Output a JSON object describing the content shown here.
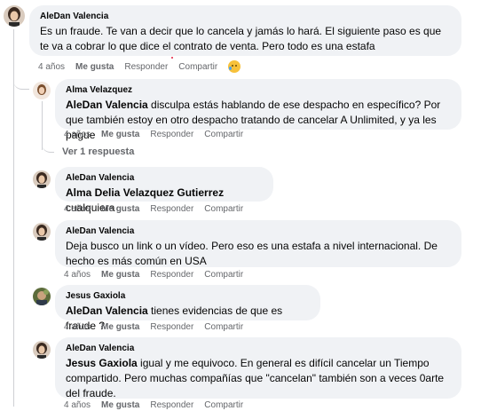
{
  "comments": [
    {
      "author": "AleDan Valencia",
      "mention": "",
      "text": "Es un fraude. Te van a decir que lo cancela y jamás lo hará. El siguiente paso es que te va a cobrar lo que dice el contrato de venta. Pero todo es una estafa",
      "time": "4 años",
      "like": "Me gusta",
      "reply": "Responder",
      "share": "Compartir",
      "reaction_icon": "crying-face-icon"
    },
    {
      "author": "Alma Velazquez",
      "mention": "AleDan Valencia",
      "text": " disculpa estás hablando de ese despacho en específico? Por que también estoy en otro despacho tratando de cancelar A Unlimited, y ya les pague",
      "time": "4 años",
      "like": "Me gusta",
      "reply": "Responder",
      "share": "Compartir"
    },
    {
      "author": "AleDan Valencia",
      "mention": "Alma Delia Velazquez Gutierrez",
      "text": " cualquiera",
      "time": "4 años",
      "like": "Me gusta",
      "reply": "Responder",
      "share": "Compartir"
    },
    {
      "author": "AleDan Valencia",
      "mention": "",
      "text": "Deja busco un link o un vídeo. Pero eso es una estafa a nivel internacional. De hecho es más común en USA",
      "time": "4 años",
      "like": "Me gusta",
      "reply": "Responder",
      "share": "Compartir"
    },
    {
      "author": "Jesus Gaxiola",
      "mention": "AleDan Valencia",
      "text": " tienes evidencias de que es fraude ?",
      "time": "4 años",
      "like": "Me gusta",
      "reply": "Responder",
      "share": "Compartir"
    },
    {
      "author": "AleDan Valencia",
      "mention": "Jesus Gaxiola",
      "text": " igual y me equivoco. En general es difícil cancelar un Tiempo compartido. Pero muchas compañías que \"cancelan\" también son a veces 0arte del fraude.",
      "time": "4 años",
      "like": "Me gusta",
      "reply": "Responder",
      "share": "Compartir"
    }
  ],
  "view_replies": "Ver 1 respuesta",
  "colors": {
    "bubble": "#f0f2f5",
    "meta_text": "#65676b",
    "thread_line": "#ced0d4"
  }
}
